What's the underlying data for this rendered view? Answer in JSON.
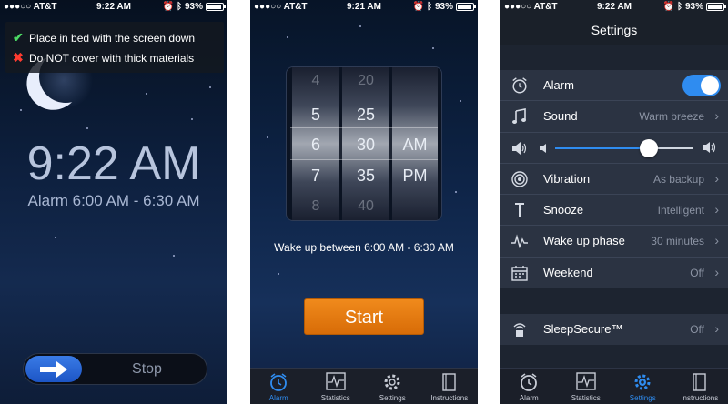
{
  "status": {
    "carrier": "●●●○○ AT&T",
    "battery": "93%",
    "screen1_time": "9:22 AM",
    "screen2_time": "9:21 AM",
    "screen3_time": "9:22 AM"
  },
  "screen1": {
    "tips": [
      "Place in bed with the screen down",
      "Do NOT cover with thick materials"
    ],
    "clock": "9:22 AM",
    "alarm_range": "Alarm 6:00 AM - 6:30 AM",
    "stop_label": "Stop"
  },
  "screen2": {
    "picker": {
      "hours": [
        "4",
        "5",
        "6",
        "7",
        "8"
      ],
      "minutes": [
        "20",
        "25",
        "30",
        "35",
        "40"
      ],
      "ampm": [
        "AM",
        "PM"
      ],
      "selected": {
        "hour": "6",
        "minute": "30",
        "ampm": "AM"
      }
    },
    "wake_text": "Wake up between 6:00 AM - 6:30 AM",
    "start_label": "Start"
  },
  "tabs": [
    "Alarm",
    "Statistics",
    "Settings",
    "Instructions"
  ],
  "screen3": {
    "title": "Settings",
    "rows": [
      {
        "label": "Alarm",
        "value": "",
        "icon": "alarm-clock-icon"
      },
      {
        "label": "Sound",
        "value": "Warm breeze",
        "icon": "music-note-icon"
      },
      {
        "label": "",
        "value": "",
        "icon": "speaker-icon"
      },
      {
        "label": "Vibration",
        "value": "As backup",
        "icon": "vibration-icon"
      },
      {
        "label": "Snooze",
        "value": "Intelligent",
        "icon": "snooze-icon"
      },
      {
        "label": "Wake up phase",
        "value": "30 minutes",
        "icon": "wave-icon"
      },
      {
        "label": "Weekend",
        "value": "Off",
        "icon": "calendar-icon"
      }
    ],
    "alarm_on": true,
    "volume_level": 0.68,
    "secure": {
      "label": "SleepSecure™",
      "value": "Off"
    }
  },
  "colors": {
    "accent": "#2f8cf0",
    "start_button": "#e47a10",
    "check": "#4cd964",
    "cross": "#ff3b30"
  }
}
